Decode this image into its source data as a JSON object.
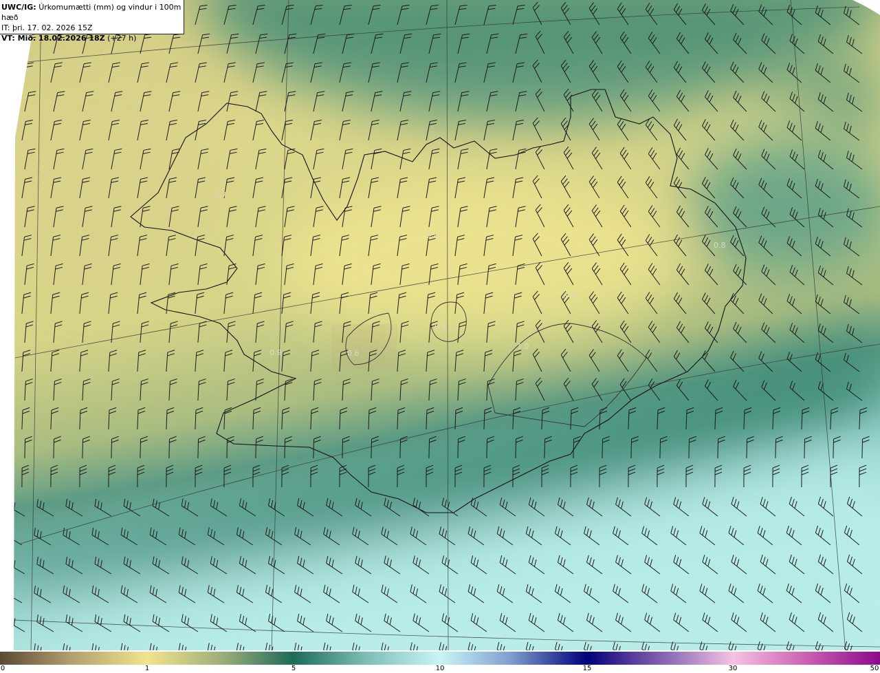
{
  "title": {
    "model": "UWC/IG:",
    "description": "Úrkomumætti (mm) og vindur i 100m hæð",
    "initial_time": "IT: þri. 17. 02. 2026 15Z",
    "valid_prefix": "VT: Mið. 18.02.2026 18Z",
    "valid_offset": "(+27 h)"
  },
  "map": {
    "region": "Iceland",
    "value_labels": [
      "0.9",
      "1.0",
      "0.5",
      "0.6",
      "1.0",
      "0.7",
      "0.9",
      "0.8"
    ]
  },
  "colorbar": {
    "ticks": [
      "0",
      "1",
      "5",
      "10",
      "15",
      "30",
      "50"
    ],
    "colors": [
      "#5a4a35",
      "#f3e38e",
      "#1e6b58",
      "#c9f5f5",
      "#00007a",
      "#f6c2e2",
      "#8a0a8a"
    ]
  }
}
